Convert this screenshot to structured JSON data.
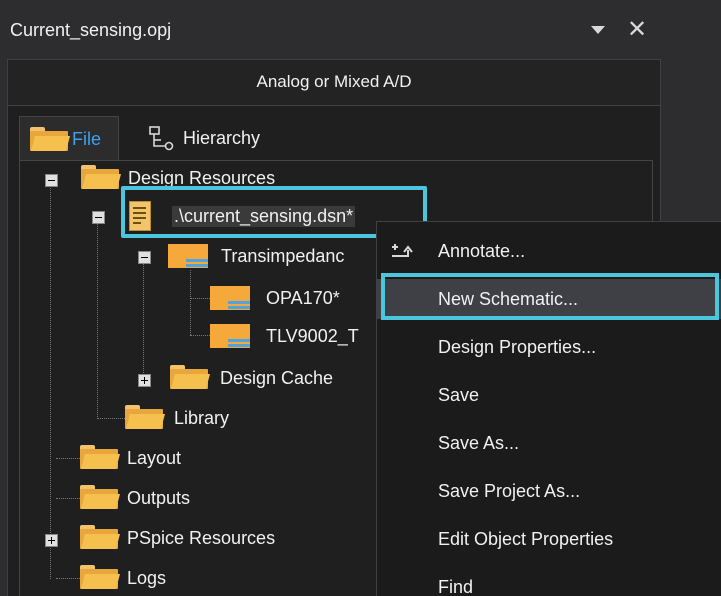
{
  "window": {
    "title": "Current_sensing.opj",
    "dropdown_icon": "chevron-down-icon",
    "close_label": "✕"
  },
  "panel": {
    "header": "Analog or Mixed A/D",
    "tabs": [
      {
        "label": "File",
        "icon": "folder-icon"
      },
      {
        "label": "Hierarchy",
        "icon": "hierarchy-icon"
      }
    ]
  },
  "tree": {
    "design_resources": "Design Resources",
    "design_file": ".\\current_sensing.dsn*",
    "transimpedance": "Transimpedanc",
    "opa170": "OPA170*",
    "tlv9002": "TLV9002_T",
    "design_cache": "Design Cache",
    "library": "Library",
    "layout": "Layout",
    "outputs": "Outputs",
    "pspice_resources": "PSpice Resources",
    "logs": "Logs"
  },
  "context_menu": {
    "items": [
      {
        "label": "Annotate...",
        "icon": "annotate-icon"
      },
      {
        "label": "New Schematic...",
        "selected": true
      },
      {
        "label": "Design Properties..."
      },
      {
        "label": "Save"
      },
      {
        "label": "Save As..."
      },
      {
        "label": "Save Project As..."
      },
      {
        "label": "Edit Object Properties"
      },
      {
        "label": "Find"
      }
    ]
  },
  "colors": {
    "highlight": "#4dc6dd",
    "accent_tab": "#3ea0f5",
    "folder": "#f6c04e"
  }
}
